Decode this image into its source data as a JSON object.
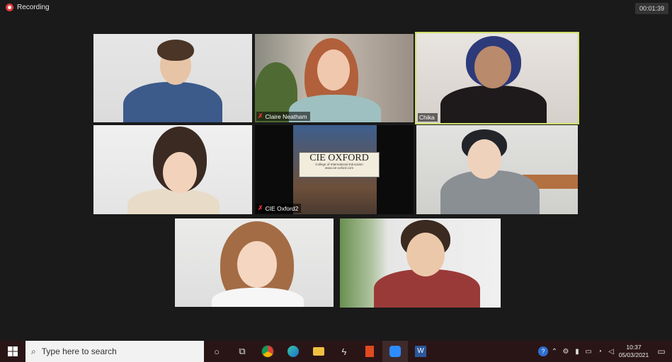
{
  "recording": {
    "label": "Recording",
    "elapsed": "00:01:39"
  },
  "participants": [
    {
      "name": "",
      "active": false
    },
    {
      "name": "Claire Neatham",
      "active": false
    },
    {
      "name": "Chika",
      "active": true
    },
    {
      "name": "",
      "active": false
    },
    {
      "name": "CIE Oxford2",
      "active": false
    },
    {
      "name": "",
      "active": false
    },
    {
      "name": "",
      "active": false
    },
    {
      "name": "",
      "active": false
    }
  ],
  "sign": {
    "title": "CIE OXFORD",
    "subtitle": "College of International Education",
    "url": "www.cie-oxford.com"
  },
  "taskbar": {
    "search_placeholder": "Type here to search",
    "apps": [
      "task-view",
      "chrome",
      "edge",
      "file-explorer",
      "app",
      "office",
      "zoom",
      "word"
    ],
    "time": "10:37",
    "date": "05/03/2021"
  },
  "colors": {
    "active_border": "#cfe06a",
    "recording": "#e03b3b",
    "taskbar": "#2a1516"
  }
}
